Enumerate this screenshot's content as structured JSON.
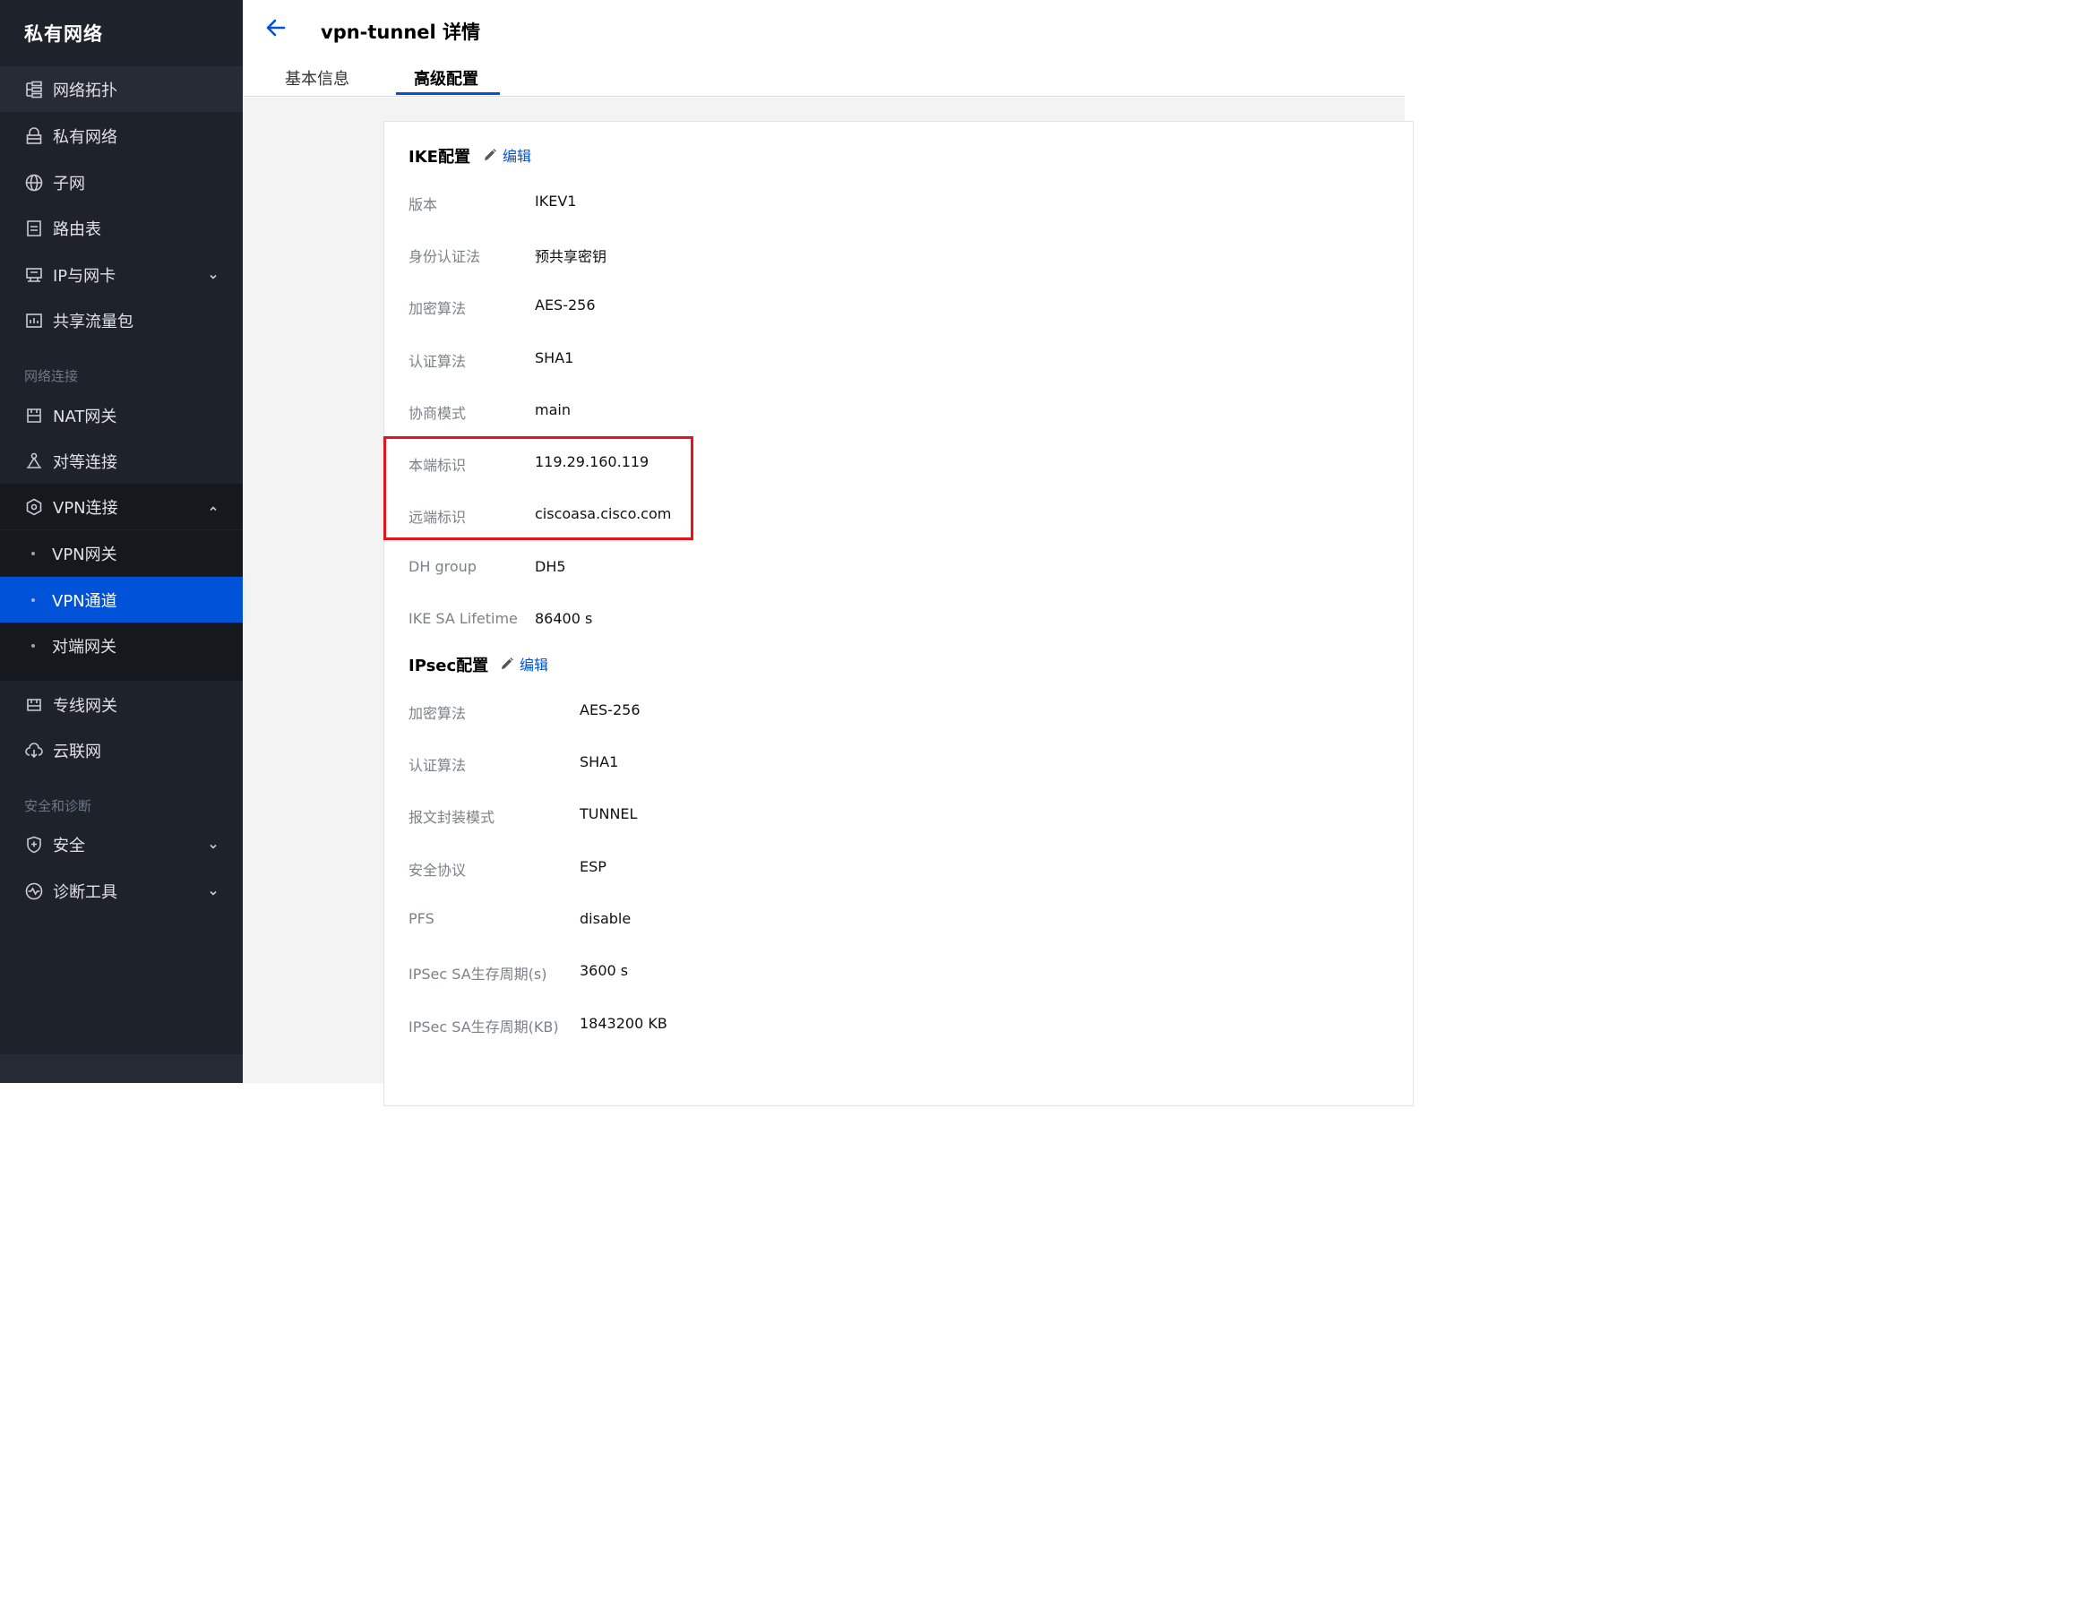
{
  "sidebar": {
    "title": "私有网络",
    "items": [
      {
        "label": "网络拓扑",
        "icon": "topology-icon"
      },
      {
        "label": "私有网络",
        "icon": "lock-icon"
      },
      {
        "label": "子网",
        "icon": "globe-icon"
      },
      {
        "label": "路由表",
        "icon": "document-icon"
      },
      {
        "label": "IP与网卡",
        "icon": "network-card-icon"
      },
      {
        "label": "共享流量包",
        "icon": "bandwidth-icon"
      }
    ],
    "group_network": "网络连接",
    "network_items": [
      {
        "label": "NAT网关",
        "icon": "nat-gateway-icon"
      },
      {
        "label": "对等连接",
        "icon": "peering-icon"
      },
      {
        "label": "VPN连接",
        "icon": "vpn-icon"
      }
    ],
    "vpn_sub": [
      {
        "label": "VPN网关"
      },
      {
        "label": "VPN通道"
      },
      {
        "label": "对端网关"
      }
    ],
    "more_items": [
      {
        "label": "专线网关",
        "icon": "direct-connect-icon"
      },
      {
        "label": "云联网",
        "icon": "ccn-icon"
      }
    ],
    "group_security": "安全和诊断",
    "security_items": [
      {
        "label": "安全",
        "icon": "shield-icon"
      },
      {
        "label": "诊断工具",
        "icon": "diagnose-icon"
      }
    ]
  },
  "header": {
    "title": "vpn-tunnel 详情",
    "tabs": [
      {
        "label": "基本信息"
      },
      {
        "label": "高级配置"
      }
    ]
  },
  "ike": {
    "title": "IKE配置",
    "edit_label": "编辑",
    "rows": [
      {
        "key": "版本",
        "value": "IKEV1"
      },
      {
        "key": "身份认证法",
        "value": "预共享密钥"
      },
      {
        "key": "加密算法",
        "value": "AES-256"
      },
      {
        "key": "认证算法",
        "value": "SHA1"
      },
      {
        "key": "协商模式",
        "value": "main"
      },
      {
        "key": "本端标识",
        "value": "119.29.160.119"
      },
      {
        "key": "远端标识",
        "value": "ciscoasa.cisco.com"
      },
      {
        "key": "DH group",
        "value": "DH5"
      },
      {
        "key": "IKE SA Lifetime",
        "value": "86400 s"
      }
    ]
  },
  "ipsec": {
    "title": "IPsec配置",
    "edit_label": "编辑",
    "rows": [
      {
        "key": "加密算法",
        "value": "AES-256"
      },
      {
        "key": "认证算法",
        "value": "SHA1"
      },
      {
        "key": "报文封装模式",
        "value": "TUNNEL"
      },
      {
        "key": "安全协议",
        "value": "ESP"
      },
      {
        "key": "PFS",
        "value": "disable"
      },
      {
        "key": "IPSec SA生存周期(s)",
        "value": "3600 s"
      },
      {
        "key": "IPSec SA生存周期(KB)",
        "value": "1843200 KB"
      }
    ]
  },
  "colors": {
    "sidebar_bg": "#1e222b",
    "active": "#0052d9",
    "highlight": "#e5141c"
  }
}
